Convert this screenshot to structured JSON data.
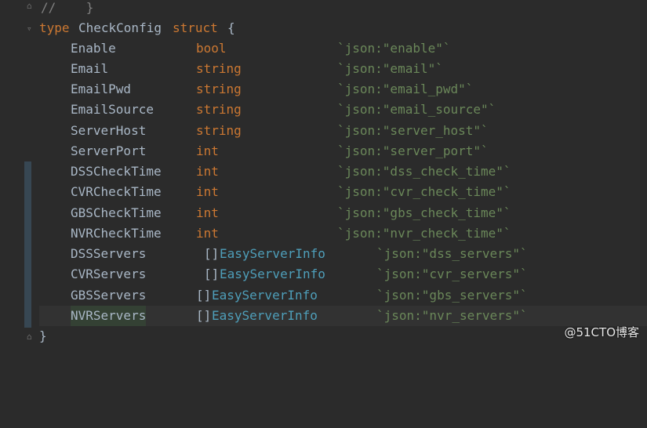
{
  "code": {
    "comment_line": "//    }",
    "struct_header": {
      "kw_type": "type",
      "name": "CheckConfig",
      "kw_struct": "struct",
      "brace": "{"
    },
    "fields": [
      {
        "name": "Enable",
        "type": "bool",
        "tag": "`json:\"enable\"`"
      },
      {
        "name": "Email",
        "type": "string",
        "tag": "`json:\"email\"`"
      },
      {
        "name": "EmailPwd",
        "type": "string",
        "tag": "`json:\"email_pwd\"`"
      },
      {
        "name": "EmailSource",
        "type": "string",
        "tag": "`json:\"email_source\"`"
      },
      {
        "name": "ServerHost",
        "type": "string",
        "tag": "`json:\"server_host\"`"
      },
      {
        "name": "ServerPort",
        "type": "int",
        "tag": "`json:\"server_port\"`"
      },
      {
        "name": "DSSCheckTime",
        "type": "int",
        "tag": "`json:\"dss_check_time\"`"
      },
      {
        "name": "CVRCheckTime",
        "type": "int",
        "tag": "`json:\"cvr_check_time\"`"
      },
      {
        "name": "GBSCheckTime",
        "type": "int",
        "tag": "`json:\"gbs_check_time\"`"
      },
      {
        "name": "NVRCheckTime",
        "type": "int",
        "tag": "`json:\"nvr_check_time\"`"
      },
      {
        "name": "DSSServers",
        "slice": "[]",
        "type": "EasyServerInfo",
        "tag": "`json:\"dss_servers\"`"
      },
      {
        "name": "CVRServers",
        "slice": "[]",
        "type": "EasyServerInfo",
        "tag": "`json:\"cvr_servers\"`"
      },
      {
        "name": "GBSServers",
        "slice": "[]",
        "type": "EasyServerInfo",
        "tag": "`json:\"gbs_servers\"`"
      },
      {
        "name": "NVRServers",
        "slice": "[]",
        "type": "EasyServerInfo",
        "tag": "`json:\"nvr_servers\"`"
      }
    ],
    "closing_brace": "}"
  },
  "watermark": "@51CTO博客",
  "colors": {
    "background": "#2b2b2b",
    "keyword": "#cc7832",
    "identifier": "#a9b7c6",
    "string": "#6a8759",
    "type_link": "#4e9eb9",
    "comment": "#808080"
  }
}
